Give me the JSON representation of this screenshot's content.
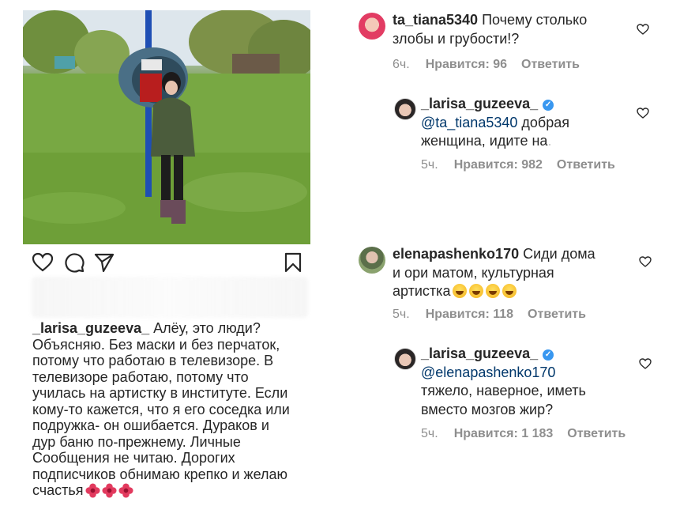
{
  "post": {
    "caption_user": "_larisa_guzeeva_",
    "caption_lines": [
      "Алёу, это люди?",
      "Объясняю. Без маски и без перчаток,",
      "потому что работаю в телевизоре. В",
      "телевизоре работаю, потому что",
      "училась на артистку в институте. Если",
      "кому-то кажется, что я его соседка или",
      "подружка- он ошибается. Дураков и",
      "дур баню по-прежнему. Личные",
      "Сообщения не читаю. Дорогих",
      "подписчиков обнимаю крепко и желаю",
      "счастья"
    ],
    "caption_emoji": "flower-emoji",
    "actions": {
      "like_icon": "heart-icon",
      "comment_icon": "comment-icon",
      "share_icon": "share-icon",
      "save_icon": "bookmark-icon"
    }
  },
  "comments": [
    {
      "user": "ta_tiana5340",
      "text_lines": [
        "Почему столько",
        "злобы и грубости!?"
      ],
      "time": "6ч.",
      "likes": "Нравится: 96",
      "reply": "Ответить"
    },
    {
      "user": "_larisa_guzeeva_",
      "verified": true,
      "mention": "@ta_tiana5340",
      "text_lines": [
        " добрая",
        "женщина, идите на"
      ],
      "time": "5ч.",
      "likes": "Нравится: 982",
      "reply": "Ответить"
    },
    {
      "user": "elenapashenko170",
      "text_lines": [
        "Сиди дома",
        "и ори матом, культурная",
        "артистка"
      ],
      "emoji_count": 4,
      "time": "5ч.",
      "likes": "Нравится: 118",
      "reply": "Ответить"
    },
    {
      "user": "_larisa_guzeeva_",
      "verified": true,
      "mention": "@elenapashenko170",
      "text_lines": [
        "тяжело, наверное, иметь",
        "вместо мозгов жир?"
      ],
      "time": "5ч.",
      "likes": "Нравится: 1 183",
      "reply": "Ответить"
    }
  ]
}
